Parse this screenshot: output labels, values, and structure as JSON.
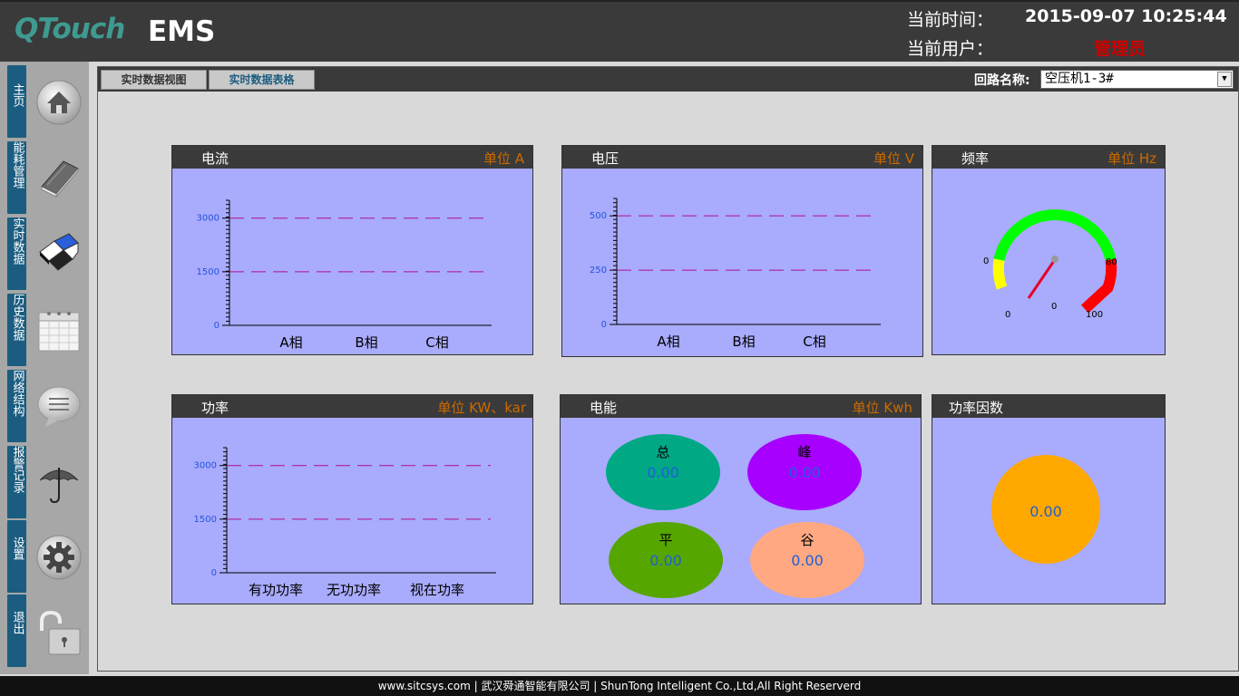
{
  "header": {
    "logo": "QTouch",
    "app_name": "EMS",
    "time_label": "当前时间：",
    "time_value": "2015-09-07 10:25:44",
    "user_label": "当前用户：",
    "user_value": "管理员"
  },
  "sidebar": {
    "items": [
      {
        "label": "主页",
        "icon": "home-icon"
      },
      {
        "label": "能耗管理",
        "icon": "book-icon"
      },
      {
        "label": "实时数据",
        "icon": "realtime-data-icon"
      },
      {
        "label": "历史数据",
        "icon": "calendar-icon"
      },
      {
        "label": "网络结构",
        "icon": "chat-bubble-icon"
      },
      {
        "label": "报警记录",
        "icon": "umbrella-icon"
      },
      {
        "label": "设置",
        "icon": "gear-icon"
      },
      {
        "label": "退出",
        "icon": "unlock-icon"
      }
    ]
  },
  "tabs": [
    {
      "label": "实时数据视图"
    },
    {
      "label": "实时数据表格"
    }
  ],
  "loop": {
    "label": "回路名称:",
    "selected": "空压机1-3#"
  },
  "current": {
    "title": "电流",
    "unit": "单位 A",
    "chart_data": {
      "type": "bar",
      "categories": [
        "A相",
        "B相",
        "C相"
      ],
      "values": [
        0,
        0,
        0
      ],
      "y_ticks": [
        0,
        1500,
        3000
      ],
      "reference_lines": [
        1500,
        3000
      ],
      "ylim": [
        0,
        3500
      ]
    }
  },
  "voltage": {
    "title": "电压",
    "unit": "单位 V",
    "chart_data": {
      "type": "bar",
      "categories": [
        "A相",
        "B相",
        "C相"
      ],
      "values": [
        0,
        0,
        0
      ],
      "y_ticks": [
        0,
        250,
        500
      ],
      "reference_lines": [
        250,
        500
      ],
      "ylim": [
        0,
        580
      ]
    }
  },
  "frequency": {
    "title": "频率",
    "unit": "单位 Hz",
    "gauge": {
      "value": 0,
      "labels": [
        "0",
        "80",
        "0",
        "100"
      ],
      "center_label": "0",
      "colors": {
        "low": "#ffff00",
        "mid": "#00ff00",
        "high": "#ff0000"
      }
    }
  },
  "power": {
    "title": "功率",
    "unit": "单位 KW、kar",
    "chart_data": {
      "type": "bar",
      "categories": [
        "有功功率",
        "无功功率",
        "视在功率"
      ],
      "values": [
        0,
        0,
        0
      ],
      "y_ticks": [
        0,
        1500,
        3000
      ],
      "reference_lines": [
        1500,
        3000
      ],
      "ylim": [
        0,
        3500
      ]
    }
  },
  "energy": {
    "title": "电能",
    "unit": "单位 Kwh",
    "items": [
      {
        "name": "总",
        "value": "0.00",
        "color": "#00a884"
      },
      {
        "name": "峰",
        "value": "0.00",
        "color": "#a800ff"
      },
      {
        "name": "平",
        "value": "0.00",
        "color": "#56a600"
      },
      {
        "name": "谷",
        "value": "0.00",
        "color": "#ffa882"
      }
    ]
  },
  "power_factor": {
    "title": "功率因数",
    "value": "0.00",
    "color": "#ffa800"
  },
  "footer": {
    "text": "www.sitcsys.com | 武汉舜通智能有限公司 | ShunTong Intelligent Co.,Ltd,All Right Reserverd"
  }
}
